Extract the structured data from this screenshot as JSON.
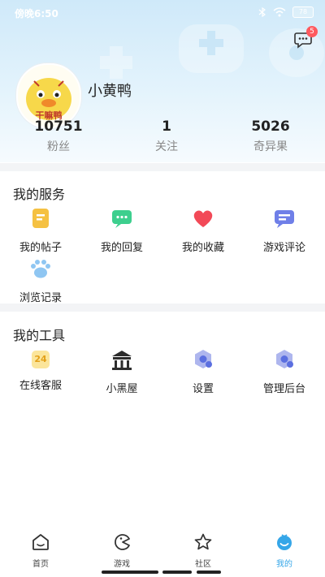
{
  "status": {
    "time": "傍晚6:50",
    "battery": "78"
  },
  "header": {
    "message_badge": "5"
  },
  "profile": {
    "username": "小黄鸭",
    "avatar_text": "干嘛鸭",
    "stats": [
      {
        "value": "10751",
        "label": "粉丝"
      },
      {
        "value": "1",
        "label": "关注"
      },
      {
        "value": "5026",
        "label": "奇异果"
      }
    ]
  },
  "services": {
    "title": "我的服务",
    "items": [
      {
        "label": "我的帖子",
        "icon": "post-icon"
      },
      {
        "label": "我的回复",
        "icon": "reply-icon"
      },
      {
        "label": "我的收藏",
        "icon": "heart-icon"
      },
      {
        "label": "游戏评论",
        "icon": "comment-icon"
      },
      {
        "label": "浏览记录",
        "icon": "paw-icon"
      }
    ]
  },
  "tools": {
    "title": "我的工具",
    "items": [
      {
        "label": "在线客服",
        "icon": "support-24-icon",
        "icon_text": "24"
      },
      {
        "label": "小黑屋",
        "icon": "house-icon"
      },
      {
        "label": "设置",
        "icon": "settings-icon"
      },
      {
        "label": "管理后台",
        "icon": "admin-icon"
      }
    ]
  },
  "tabbar": {
    "tabs": [
      {
        "label": "首页",
        "icon": "home-icon"
      },
      {
        "label": "游戏",
        "icon": "game-icon"
      },
      {
        "label": "社区",
        "icon": "star-icon"
      },
      {
        "label": "我的",
        "icon": "profile-icon"
      }
    ],
    "active_color": "#35a6e8"
  }
}
